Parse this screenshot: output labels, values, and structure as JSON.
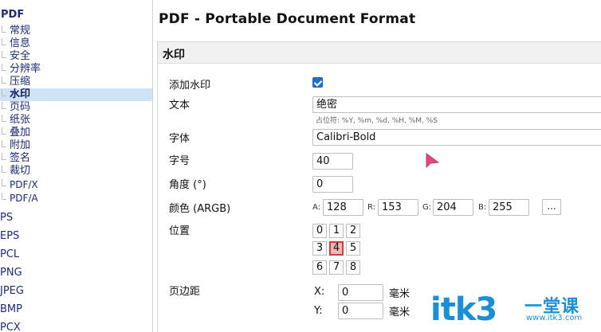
{
  "sidebar": {
    "section_title": "PDF",
    "sub_items": [
      "常规",
      "信息",
      "安全",
      "分辨率",
      "压缩",
      "水印",
      "页码",
      "纸张",
      "叠加",
      "附加",
      "签名",
      "裁切",
      "PDF/X",
      "PDF/A"
    ],
    "active_sub_item": "水印",
    "top_items": [
      "PS",
      "EPS",
      "PCL",
      "PNG",
      "JPEG",
      "BMP",
      "PCX"
    ]
  },
  "main": {
    "page_title": "PDF - Portable Document Format",
    "section_title": "水印",
    "add_watermark_label": "添加水印",
    "add_watermark_checked": true,
    "text_label": "文本",
    "text_value": "绝密",
    "text_hint": "占位符: %Y, %m, %d, %H, %M, %S",
    "font_label": "字体",
    "font_value": "Calibri-Bold",
    "size_label": "字号",
    "size_value": "40",
    "angle_label": "角度 (°)",
    "angle_value": "0",
    "color_label": "颜色 (ARGB)",
    "color": {
      "a_label": "A:",
      "a_value": "128",
      "r_label": "R:",
      "r_value": "153",
      "g_label": "G:",
      "g_value": "204",
      "b_label": "B:",
      "b_value": "255",
      "more_label": "..."
    },
    "position_label": "位置",
    "position_cells": [
      "0",
      "1",
      "2",
      "3",
      "4",
      "5",
      "6",
      "7",
      "8"
    ],
    "position_selected": "4",
    "margin_label": "页边距",
    "margin": {
      "x_label": "X:",
      "x_value": "0",
      "x_unit": "毫米",
      "y_label": "Y:",
      "y_value": "0",
      "y_unit": "毫米"
    }
  },
  "watermark_logo": {
    "main": "itk3",
    "sub": "一堂课",
    "url": "www.itk3.com"
  },
  "icons": {
    "cursor": "arrow-cursor-icon",
    "check": "check-icon"
  },
  "colors": {
    "accent": "#1f6fd1",
    "sidebar_active_bg": "#cfe3f7",
    "sidebar_text": "#1d2b73",
    "selected_cell_bg": "#f3b7b7",
    "selected_cell_border": "#d23b3b",
    "cursor": "#e2477f",
    "logo": "#1a8fd8"
  }
}
